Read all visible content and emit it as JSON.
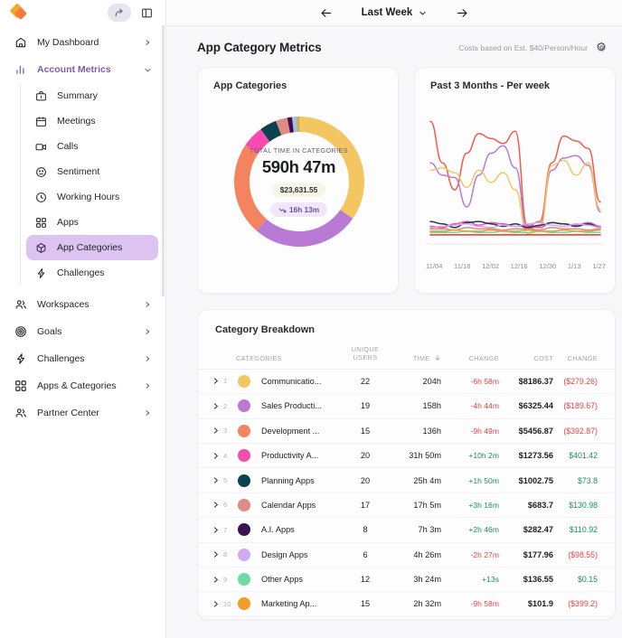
{
  "sidebar": {
    "logo_name": "app-logo",
    "toolbar": [
      {
        "name": "share-icon",
        "label": "Share"
      },
      {
        "name": "panel-toggle-icon",
        "label": "Toggle panel"
      }
    ],
    "items": [
      {
        "label": "My Dashboard",
        "icon": "home-icon",
        "chevron": "chevron-right",
        "accent": false
      },
      {
        "label": "Account Metrics",
        "icon": "bar-chart-icon",
        "chevron": "chevron-down",
        "accent": true
      }
    ],
    "subitems": [
      {
        "label": "Summary",
        "icon": "briefcase-icon",
        "selected": false
      },
      {
        "label": "Meetings",
        "icon": "calendar-icon",
        "selected": false
      },
      {
        "label": "Calls",
        "icon": "video-icon",
        "selected": false
      },
      {
        "label": "Sentiment",
        "icon": "smiley-icon",
        "selected": false
      },
      {
        "label": "Working Hours",
        "icon": "clock-icon",
        "selected": false
      },
      {
        "label": "Apps",
        "icon": "grid-icon",
        "selected": false
      },
      {
        "label": "App Categories",
        "icon": "cube-icon",
        "selected": true
      },
      {
        "label": "Challenges",
        "icon": "lightning-icon",
        "selected": false
      }
    ],
    "bottom_items": [
      {
        "label": "Workspaces",
        "icon": "people-icon",
        "chevron": "chevron-right"
      },
      {
        "label": "Goals",
        "icon": "target-icon",
        "chevron": "chevron-right"
      },
      {
        "label": "Challenges",
        "icon": "lightning-icon",
        "chevron": "chevron-right"
      },
      {
        "label": "Apps & Categories",
        "icon": "grid-icon",
        "chevron": "chevron-right"
      },
      {
        "label": "Partner Center",
        "icon": "people-icon",
        "chevron": "chevron-right"
      }
    ]
  },
  "topbar": {
    "prev_label": "←",
    "next_label": "→",
    "date_range": "Last Week"
  },
  "page": {
    "title": "App Category Metrics",
    "cost_note": "Costs based on Est. $40/Person/Hour",
    "settings_icon": "gear-icon"
  },
  "donut_card": {
    "title": "App Categories",
    "center_label": "TOTAL TIME IN CATEGORIES",
    "total_time": "590h 47m",
    "cost_pill": "$23,631.55",
    "delta_pill": "16h 13m"
  },
  "line_card": {
    "title": "Past 3 Months - Per week"
  },
  "table_card": {
    "title": "Category Breakdown",
    "columns": [
      "CATEGORIES",
      "UNIQUE USERS",
      "TIME",
      "CHANGE",
      "COST",
      "CHANGE"
    ],
    "col_unique_1": "UNIQUE",
    "col_unique_2": "USERS",
    "col_categories": "CATEGORIES",
    "col_time": "TIME",
    "col_change1": "CHANGE",
    "col_cost": "COST",
    "col_change2": "CHANGE",
    "sort_icon": "arrow-down-icon",
    "rows": [
      {
        "num": "1",
        "color": "#f4c662",
        "name": "Communicatio...",
        "users": "22",
        "time": "204h",
        "change": "-6h 58m",
        "change_sign": "neg",
        "cost": "$8186.37",
        "cost_change": "($279.26)",
        "cost_sign": "neg"
      },
      {
        "num": "2",
        "color": "#b87ad4",
        "name": "Sales Producti...",
        "users": "19",
        "time": "158h",
        "change": "-4h 44m",
        "change_sign": "neg",
        "cost": "$6325.44",
        "cost_change": "($189.67)",
        "cost_sign": "neg"
      },
      {
        "num": "3",
        "color": "#f4845f",
        "name": "Development ...",
        "users": "15",
        "time": "136h",
        "change": "-9h 49m",
        "change_sign": "neg",
        "cost": "$5456.87",
        "cost_change": "($392.87)",
        "cost_sign": "neg"
      },
      {
        "num": "4",
        "color": "#f74bb0",
        "name": "Productivity A...",
        "users": "20",
        "time": "31h 50m",
        "change": "+10h 2m",
        "change_sign": "pos",
        "cost": "$1273.56",
        "cost_change": "$401.42",
        "cost_sign": "pos"
      },
      {
        "num": "5",
        "color": "#0d4250",
        "name": "Planning Apps",
        "users": "20",
        "time": "25h 4m",
        "change": "+1h 50m",
        "change_sign": "pos",
        "cost": "$1002.75",
        "cost_change": "$73.8",
        "cost_sign": "pos"
      },
      {
        "num": "6",
        "color": "#de8b85",
        "name": "Calendar Apps",
        "users": "17",
        "time": "17h 5m",
        "change": "+3h 16m",
        "change_sign": "pos",
        "cost": "$683.7",
        "cost_change": "$130.98",
        "cost_sign": "pos"
      },
      {
        "num": "7",
        "color": "#3a1452",
        "name": "A.I. Apps",
        "users": "8",
        "time": "7h 3m",
        "change": "+2h 46m",
        "change_sign": "pos",
        "cost": "$282.47",
        "cost_change": "$110.92",
        "cost_sign": "pos"
      },
      {
        "num": "8",
        "color": "#cdaaf2",
        "name": "Design Apps",
        "users": "6",
        "time": "4h 26m",
        "change": "-2h 27m",
        "change_sign": "neg",
        "cost": "$177.96",
        "cost_change": "($98.55)",
        "cost_sign": "neg"
      },
      {
        "num": "9",
        "color": "#6fdaa6",
        "name": "Other Apps",
        "users": "12",
        "time": "3h 24m",
        "change": "+13s",
        "change_sign": "pos",
        "cost": "$136.55",
        "cost_change": "$0.15",
        "cost_sign": "pos"
      },
      {
        "num": "10",
        "color": "#f59b2a",
        "name": "Marketing Ap...",
        "users": "15",
        "time": "2h 32m",
        "change": "-9h 58m",
        "change_sign": "neg",
        "cost": "$101.9",
        "cost_change": "($399.2)",
        "cost_sign": "neg"
      }
    ]
  },
  "chart_data": [
    {
      "type": "pie",
      "title": "App Categories",
      "subtitle": "TOTAL TIME IN CATEGORIES",
      "center_value": "590h 47m",
      "labels": [
        "Communication Apps",
        "Sales Productivity",
        "Development Apps",
        "Productivity Apps",
        "Planning Apps",
        "Calendar Apps",
        "A.I. Apps",
        "Design Apps",
        "Other Apps",
        "Marketing Apps"
      ],
      "values": [
        204,
        158,
        136,
        31.83,
        25.07,
        17.08,
        7.05,
        4.43,
        3.4,
        2.53
      ],
      "unit": "hours",
      "colors": [
        "#f4c662",
        "#b87ad4",
        "#f4845f",
        "#f74bb0",
        "#0d4250",
        "#de8b85",
        "#3a1452",
        "#cdaaf2",
        "#6fdaa6",
        "#f59b2a"
      ],
      "legend": false,
      "donut": true
    },
    {
      "type": "line",
      "title": "Past 3 Months - Per week",
      "x": [
        "11/04",
        "11/18",
        "12/02",
        "12/16",
        "12/30",
        "1/13",
        "1/27"
      ],
      "xlabel": "",
      "ylabel": "",
      "grid": false,
      "legend": false,
      "series": [
        {
          "name": "Communication Apps",
          "color": "#f05a4f",
          "values": [
            96,
            62,
            40,
            70,
            86,
            82,
            78,
            88,
            10,
            14,
            62,
            84,
            80,
            74,
            30
          ]
        },
        {
          "name": "Sales Productivity",
          "color": "#b87ad4",
          "values": [
            62,
            52,
            50,
            26,
            52,
            70,
            76,
            58,
            8,
            10,
            56,
            66,
            68,
            60,
            22
          ]
        },
        {
          "name": "Development Apps",
          "color": "#f4c662",
          "values": [
            56,
            58,
            54,
            42,
            56,
            46,
            54,
            40,
            4,
            6,
            60,
            64,
            52,
            62,
            24
          ]
        },
        {
          "name": "Productivity Apps",
          "color": "#f74bb0",
          "values": [
            10,
            9,
            12,
            14,
            11,
            13,
            12,
            10,
            11,
            9,
            13,
            12,
            11,
            13,
            10
          ]
        },
        {
          "name": "Planning Apps",
          "color": "#1b3b46",
          "values": [
            14,
            12,
            9,
            13,
            14,
            12,
            10,
            12,
            9,
            11,
            13,
            12,
            10,
            12,
            9
          ]
        },
        {
          "name": "Calendar Apps",
          "color": "#de8b85",
          "values": [
            8,
            8,
            7,
            9,
            8,
            8,
            7,
            8,
            8,
            7,
            9,
            8,
            8,
            7,
            8
          ]
        },
        {
          "name": "A.I. Apps",
          "color": "#cdaaf2",
          "values": [
            9,
            10,
            11,
            12,
            10,
            9,
            11,
            10,
            12,
            13,
            11,
            10,
            12,
            11,
            9
          ]
        },
        {
          "name": "Design Apps",
          "color": "#6fdaa6",
          "values": [
            5,
            5,
            5,
            6,
            5,
            5,
            6,
            5,
            5,
            6,
            5,
            5,
            6,
            5,
            5
          ]
        },
        {
          "name": "Other Apps",
          "color": "#f59b2a",
          "values": [
            6,
            6,
            7,
            6,
            6,
            7,
            6,
            6,
            7,
            6,
            6,
            7,
            6,
            6,
            7
          ]
        },
        {
          "name": "Marketing Apps",
          "color": "#e8332a",
          "values": [
            3,
            3,
            3,
            3,
            3,
            3,
            3,
            3,
            3,
            3,
            3,
            3,
            3,
            3,
            3
          ]
        }
      ]
    }
  ]
}
